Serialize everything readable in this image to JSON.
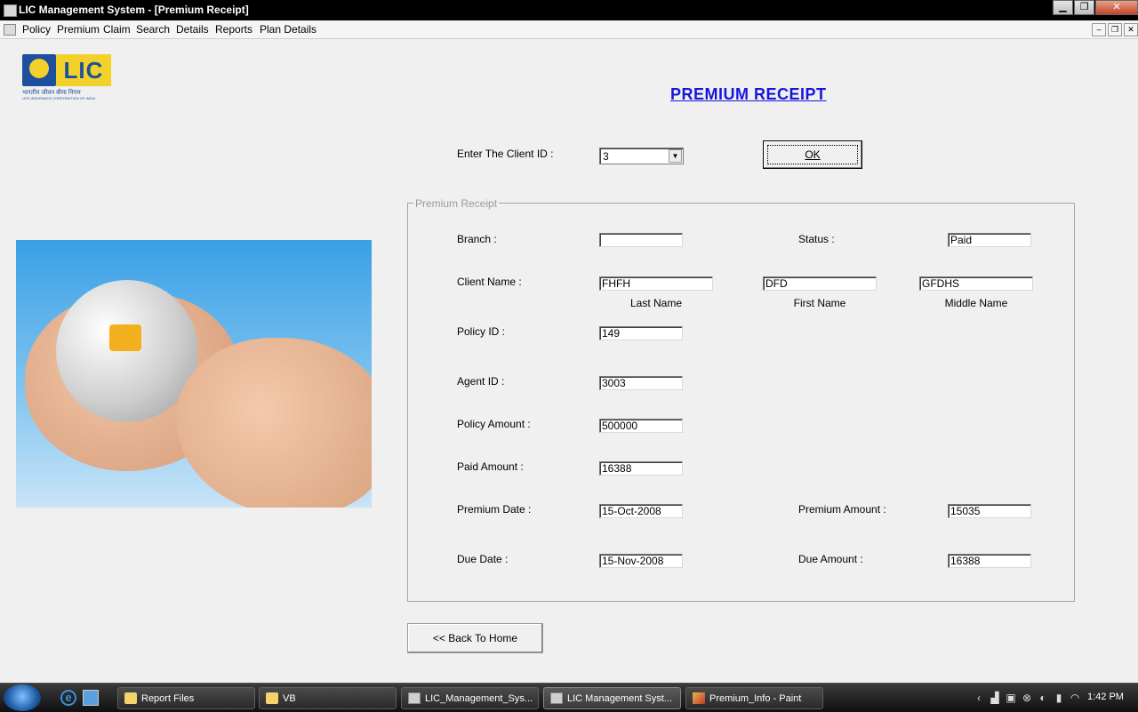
{
  "window": {
    "title": "LIC Management System - [Premium Receipt]",
    "minimize_label": "▁",
    "restore_label": "❐",
    "close_label": "✕"
  },
  "menubar": {
    "items": [
      "Policy",
      "Premium",
      "Claim",
      "Search",
      "Details",
      "Reports",
      "Plan Details"
    ],
    "mdi_minimize": "–",
    "mdi_restore": "❐",
    "mdi_close": "✕"
  },
  "logo": {
    "text": "LIC",
    "hindi": "भारतीय जीवन बीमा निगम",
    "english": "LIFE INSURANCE CORPORATION OF INDIA"
  },
  "form": {
    "heading": "PREMIUM  RECEIPT",
    "client_id_label": "Enter The Client ID :",
    "client_id_value": "3",
    "dropdown_arrow": "▼",
    "ok_label": "OK",
    "group_title": "Premium  Receipt",
    "branch_label": "Branch :",
    "branch_value": "",
    "status_label": "Status :",
    "status_value": "Paid",
    "client_name_label": "Client Name :",
    "last_name_value": "FHFH",
    "first_name_value": "DFD",
    "middle_name_value": "GFDHS",
    "last_name_caption": "Last Name",
    "first_name_caption": "First Name",
    "middle_name_caption": "Middle Name",
    "policy_id_label": "Policy ID :",
    "policy_id_value": "149",
    "agent_id_label": "Agent ID :",
    "agent_id_value": "3003",
    "policy_amount_label": "Policy Amount :",
    "policy_amount_value": "500000",
    "paid_amount_label": "Paid Amount :",
    "paid_amount_value": "16388",
    "premium_date_label": "Premium Date :",
    "premium_date_value": "15-Oct-2008",
    "premium_amount_label": "Premium Amount :",
    "premium_amount_value": "15035",
    "due_date_label": "Due Date :",
    "due_date_value": "15-Nov-2008",
    "due_amount_label": "Due Amount :",
    "due_amount_value": "16388",
    "back_label": "<< Back To Home"
  },
  "taskbar": {
    "items": [
      {
        "label": "Report Files",
        "icon": "folder-icon"
      },
      {
        "label": "VB",
        "icon": "folder-icon"
      },
      {
        "label": "LIC_Management_Sys...",
        "icon": "app-icon"
      },
      {
        "label": "LIC Management Syst...",
        "icon": "app-icon"
      },
      {
        "label": "Premium_Info - Paint",
        "icon": "paint-icon"
      }
    ],
    "clock": "1:42 PM"
  },
  "colors": {
    "heading": "#1515e0",
    "title_bar": "#000000",
    "background": "#f0f0f0"
  }
}
